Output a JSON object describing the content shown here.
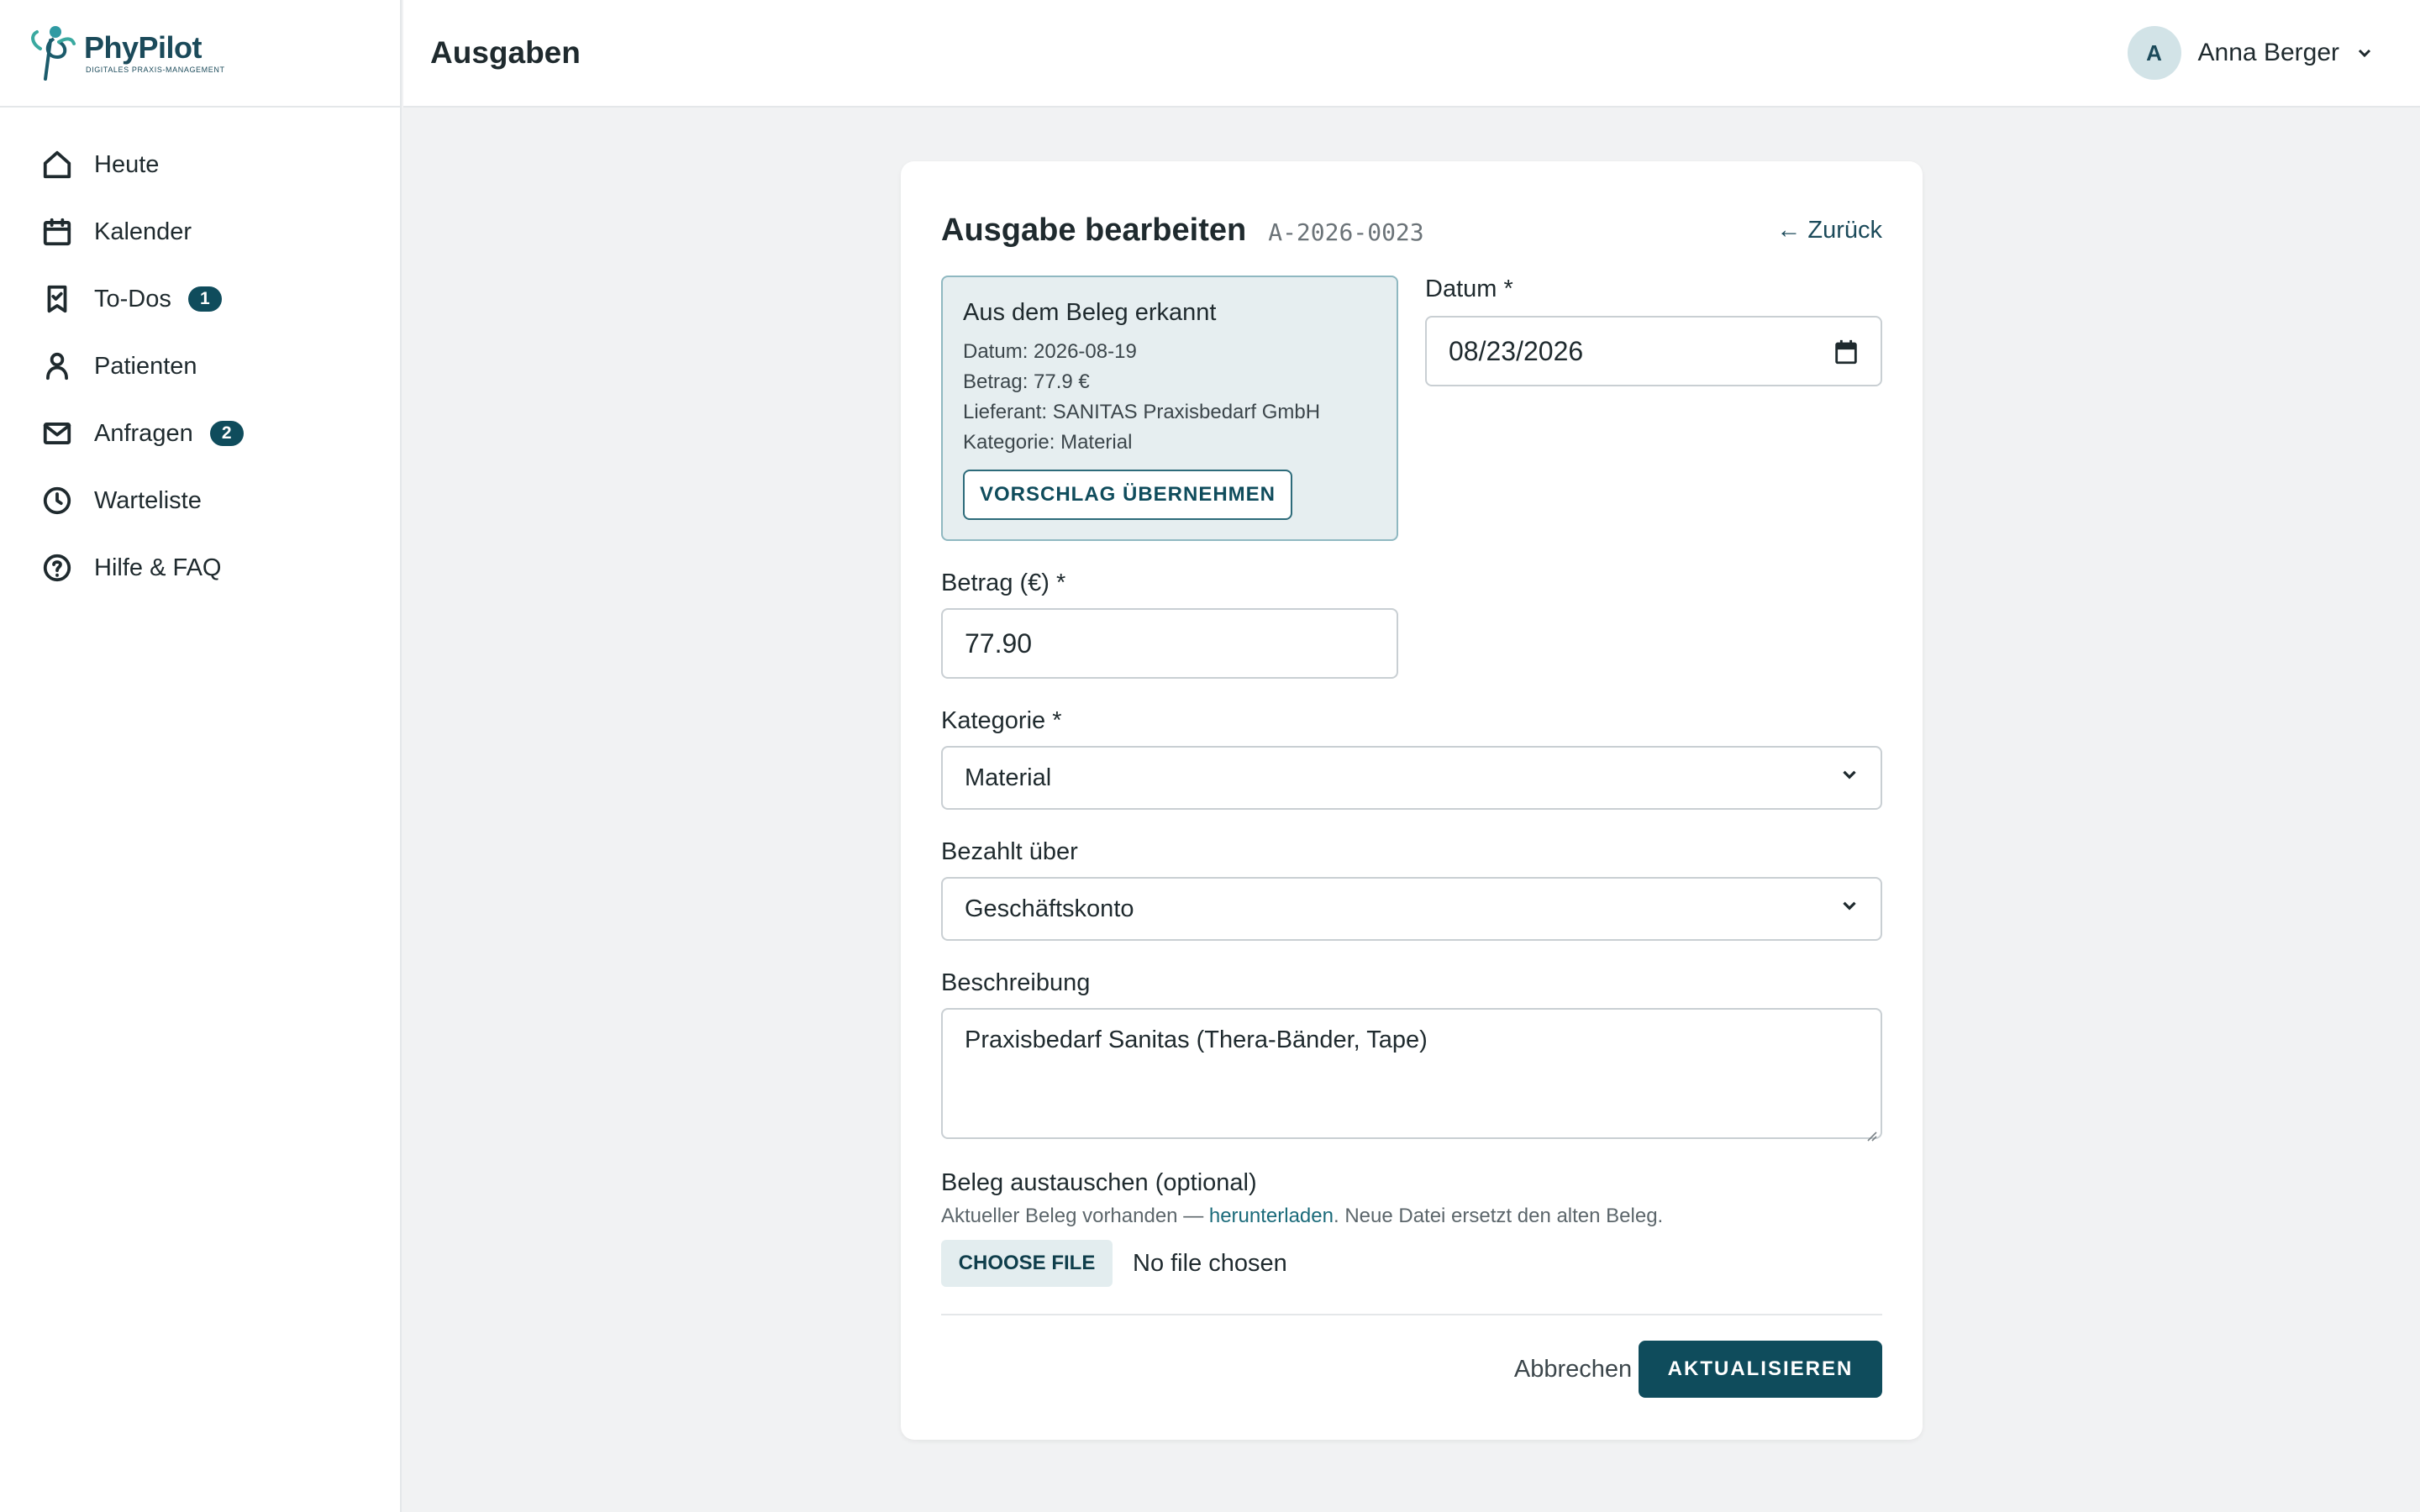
{
  "brand": {
    "name": "PhyPilot",
    "tagline": "DIGITALES PRAXIS-MANAGEMENT"
  },
  "sidebar": {
    "items": [
      {
        "label": "Heute",
        "icon": "home-icon"
      },
      {
        "label": "Kalender",
        "icon": "calendar-icon"
      },
      {
        "label": "To-Dos",
        "icon": "todo-icon",
        "badge": "1"
      },
      {
        "label": "Patienten",
        "icon": "person-icon"
      },
      {
        "label": "Anfragen",
        "icon": "mail-icon",
        "badge": "2"
      },
      {
        "label": "Warteliste",
        "icon": "clock-icon"
      },
      {
        "label": "Hilfe & FAQ",
        "icon": "help-icon"
      }
    ]
  },
  "header": {
    "title": "Ausgaben",
    "user": {
      "initial": "A",
      "name": "Anna Berger"
    }
  },
  "form": {
    "title": "Ausgabe bearbeiten",
    "id": "A-2026-0023",
    "back_label": "← Zurück",
    "suggestion": {
      "title": "Aus dem Beleg erkannt",
      "lines": [
        "Datum: 2026-08-19",
        "Betrag: 77.9 €",
        "Lieferant: SANITAS Praxisbedarf GmbH",
        "Kategorie: Material"
      ],
      "button": "VORSCHLAG ÜBERNEHMEN"
    },
    "date": {
      "label": "Datum *",
      "value": "08/23/2026"
    },
    "amount": {
      "label": "Betrag (€) *",
      "value": "77.90"
    },
    "category": {
      "label": "Kategorie *",
      "value": "Material"
    },
    "paid_via": {
      "label": "Bezahlt über",
      "value": "Geschäftskonto"
    },
    "description": {
      "label": "Beschreibung",
      "value": "Praxisbedarf Sanitas (Thera-Bänder, Tape)"
    },
    "receipt": {
      "label": "Beleg austauschen (optional)",
      "hint_prefix": "Aktueller Beleg vorhanden — ",
      "hint_link": "herunterladen",
      "hint_suffix": ". Neue Datei ersetzt den alten Beleg.",
      "choose_label": "CHOOSE FILE",
      "status": "No file chosen"
    },
    "cancel_label": "Abbrechen",
    "submit_label": "AKTUALISIEREN"
  },
  "colors": {
    "accent": "#0f4c5c",
    "suggest_bg": "#e6eef0",
    "page_bg": "#f1f2f3"
  }
}
